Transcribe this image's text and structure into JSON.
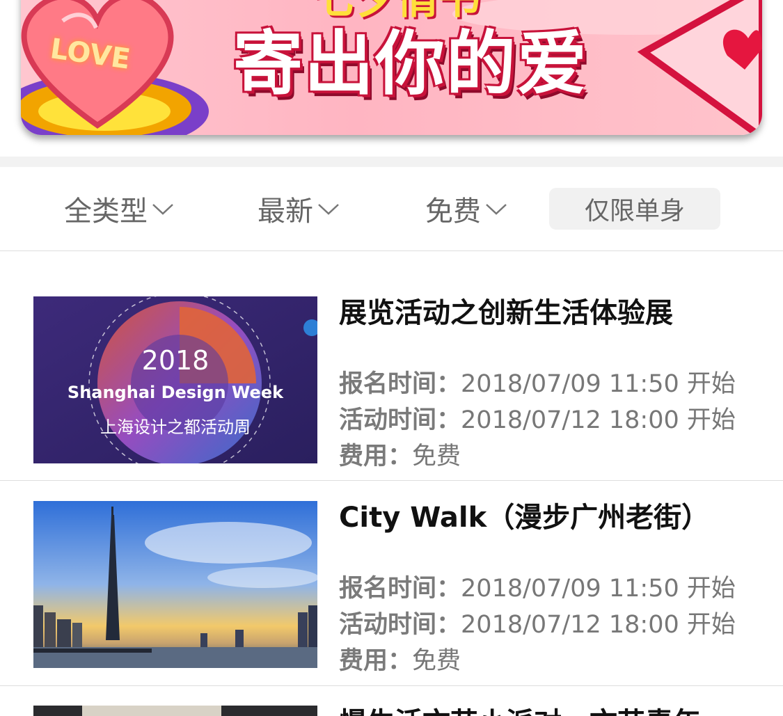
{
  "banner": {
    "headline": "寄出你的爱",
    "top_text": "七夕情书",
    "badge": "LOVE",
    "icons": [
      "heart-icon",
      "envelope-icon"
    ]
  },
  "filters": [
    {
      "label": "全类型",
      "icon": "chevron-down-icon"
    },
    {
      "label": "最新",
      "icon": "chevron-down-icon"
    },
    {
      "label": "免费",
      "icon": "chevron-down-icon"
    },
    {
      "label": "仅限单身"
    }
  ],
  "events": [
    {
      "title": "展览活动之创新生活体验展",
      "image": {
        "year": "2018",
        "english": "Shanghai Design Week",
        "chinese": "上海设计之都活动周"
      },
      "signup_label": "报名时间",
      "signup_value": "2018/07/09 11:50 开始",
      "event_label": "活动时间",
      "event_value": "2018/07/12 18:00 开始",
      "fee_label": "费用",
      "fee_value": "免费"
    },
    {
      "title": "City Walk（漫步广州老街）",
      "signup_label": "报名时间",
      "signup_value": "2018/07/09 11:50 开始",
      "event_label": "活动时间",
      "event_value": "2018/07/12 18:00 开始",
      "fee_label": "费用",
      "fee_value": "免费"
    },
    {
      "title": "慢生活文艺小派对，文艺青年"
    }
  ],
  "colors": {
    "banner_pink": "#ffb5c2",
    "text_gray": "#777777",
    "title": "#111111",
    "divider": "#dddddd"
  }
}
